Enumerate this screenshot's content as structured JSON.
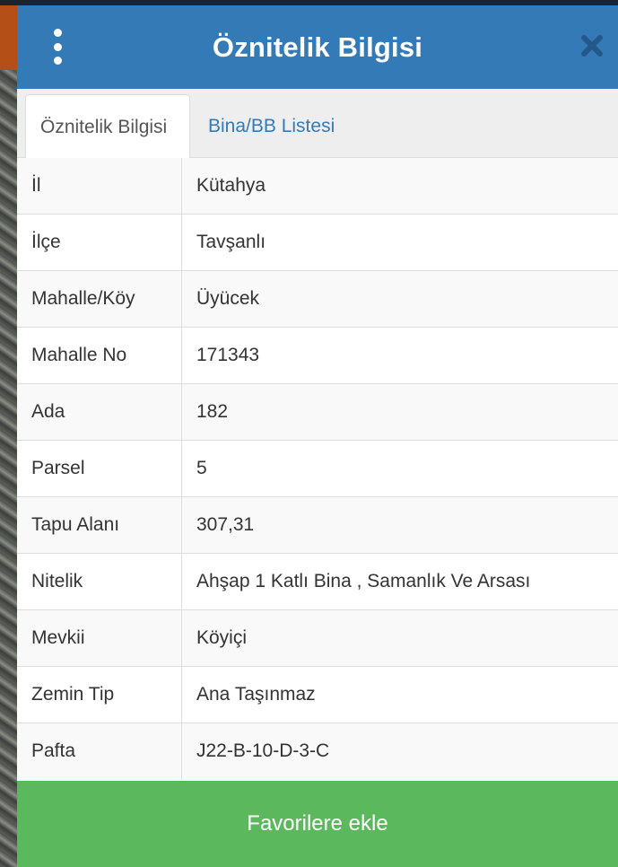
{
  "header": {
    "title": "Öznitelik Bilgisi",
    "menu_icon": "kebab-menu-icon",
    "close_icon": "close-icon"
  },
  "tabs": [
    {
      "label": "Öznitelik Bilgisi",
      "active": true
    },
    {
      "label": "Bina/BB Listesi",
      "active": false
    }
  ],
  "attributes": [
    {
      "label": "İl",
      "value": "Kütahya"
    },
    {
      "label": "İlçe",
      "value": "Tavşanlı"
    },
    {
      "label": "Mahalle/Köy",
      "value": "Üyücek"
    },
    {
      "label": "Mahalle No",
      "value": "171343"
    },
    {
      "label": "Ada",
      "value": "182"
    },
    {
      "label": "Parsel",
      "value": "5"
    },
    {
      "label": "Tapu Alanı",
      "value": "307,31"
    },
    {
      "label": "Nitelik",
      "value": "Ahşap 1 Katlı Bina , Samanlık Ve Arsası"
    },
    {
      "label": "Mevkii",
      "value": "Köyiçi"
    },
    {
      "label": "Zemin Tip",
      "value": "Ana Taşınmaz"
    },
    {
      "label": "Pafta",
      "value": "J22-B-10-D-3-C"
    }
  ],
  "footer": {
    "favorites_label": "Favorilere ekle"
  },
  "colors": {
    "header": "#337ab7",
    "favorites_button": "#5cb85c",
    "tab_link": "#337ab7"
  }
}
